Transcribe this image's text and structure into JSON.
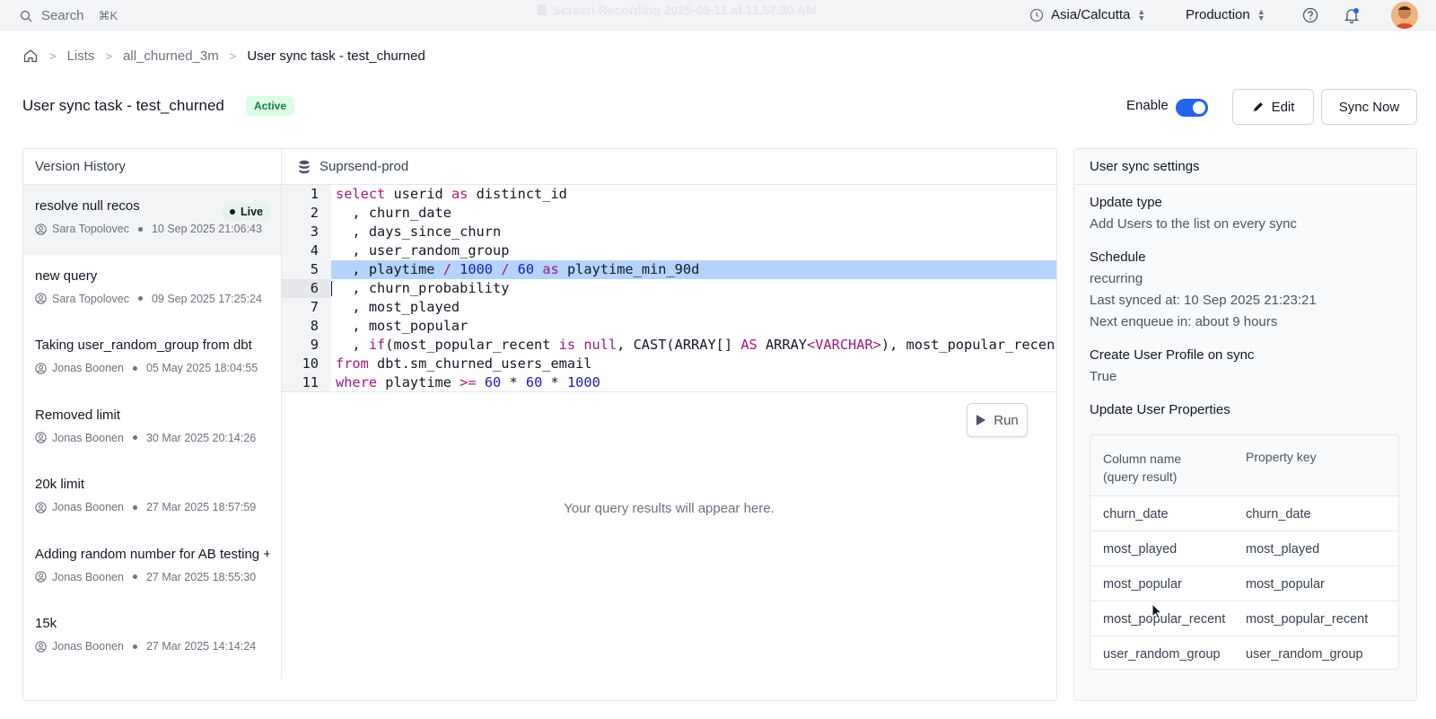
{
  "topbar": {
    "search_label": "Search",
    "search_shortcut": "⌘K",
    "recording_title": "Screen Recording 2025-09-11 at 11.57.30 AM",
    "timezone": "Asia/Calcutta",
    "environment": "Production"
  },
  "breadcrumb": {
    "items": [
      "Lists",
      "all_churned_3m"
    ],
    "current": "User sync task - test_churned"
  },
  "header": {
    "title": "User sync task - test_churned",
    "status": "Active",
    "enable_label": "Enable",
    "edit_label": "Edit",
    "sync_label": "Sync Now"
  },
  "version_history": {
    "title": "Version History",
    "live_label": "Live",
    "items": [
      {
        "name": "resolve null recos",
        "author": "Sara Topolovec",
        "date": "10 Sep 2025 21:06:43"
      },
      {
        "name": "new query",
        "author": "Sara Topolovec",
        "date": "09 Sep 2025 17:25:24"
      },
      {
        "name": "Taking user_random_group from dbt",
        "author": "Jonas Boonen",
        "date": "05 May 2025 18:04:55"
      },
      {
        "name": "Removed limit",
        "author": "Jonas Boonen",
        "date": "30 Mar 2025 20:14:26"
      },
      {
        "name": "20k limit",
        "author": "Jonas Boonen",
        "date": "27 Mar 2025 18:57:59"
      },
      {
        "name": "Adding random number for AB testing +",
        "author": "Jonas Boonen",
        "date": "27 Mar 2025 18:55:30"
      },
      {
        "name": "15k",
        "author": "Jonas Boonen",
        "date": "27 Mar 2025 14:14:24"
      }
    ]
  },
  "editor": {
    "datasource": "Suprsend-prod",
    "line_numbers": [
      "1",
      "2",
      "3",
      "4",
      "5",
      "6",
      "7",
      "8",
      "9",
      "10",
      "11"
    ],
    "lines": {
      "l1": [
        "select",
        " userid ",
        "as",
        " distinct_id"
      ],
      "l2": "  , churn_date",
      "l3": "  , days_since_churn",
      "l4": "  , user_random_group",
      "l5": [
        "  , playtime ",
        "/",
        " ",
        "1000",
        " ",
        "/",
        " ",
        "60",
        " ",
        "as",
        " playtime_min_90d"
      ],
      "l6": "  , churn_probability",
      "l7": "  , most_played",
      "l8": "  , most_popular",
      "l9": [
        "  , ",
        "if",
        "(most_popular_recent ",
        "is",
        " ",
        "null",
        ", CAST(ARRAY[] ",
        "AS",
        " ARRAY",
        "<VARCHAR>",
        "), most_popular_recen"
      ],
      "l10": [
        "from",
        " dbt.sm_churned_users_email"
      ],
      "l11": [
        "where",
        " playtime ",
        ">=",
        " ",
        "60",
        " ",
        "*",
        " ",
        "60",
        " ",
        "*",
        " ",
        "1000"
      ]
    },
    "run_label": "Run",
    "results_placeholder": "Your query results will appear here."
  },
  "settings": {
    "title": "User sync settings",
    "update_type_label": "Update type",
    "update_type_value": "Add Users to the list on every sync",
    "schedule_label": "Schedule",
    "schedule_value": "recurring",
    "last_synced": "Last synced at: 10 Sep 2025 21:23:21",
    "next_enqueue": "Next enqueue in: about 9 hours",
    "create_profile_label": "Create User Profile on sync",
    "create_profile_value": "True",
    "update_props_label": "Update User Properties",
    "table_headers": {
      "column_name": "Column name",
      "column_name_sub": "(query result)",
      "property_key": "Property key"
    },
    "rows": [
      {
        "column": "churn_date",
        "key": "churn_date"
      },
      {
        "column": "most_played",
        "key": "most_played"
      },
      {
        "column": "most_popular",
        "key": "most_popular"
      },
      {
        "column": "most_popular_recent",
        "key": "most_popular_recent"
      },
      {
        "column": "user_random_group",
        "key": "user_random_group"
      }
    ]
  },
  "colors": {
    "accent": "#2563eb",
    "active_badge_bg": "#dcfce7",
    "active_badge_text": "#15803d",
    "highlight": "#b4d4fb",
    "keyword": "#a3187f",
    "number": "#1d18b6"
  }
}
